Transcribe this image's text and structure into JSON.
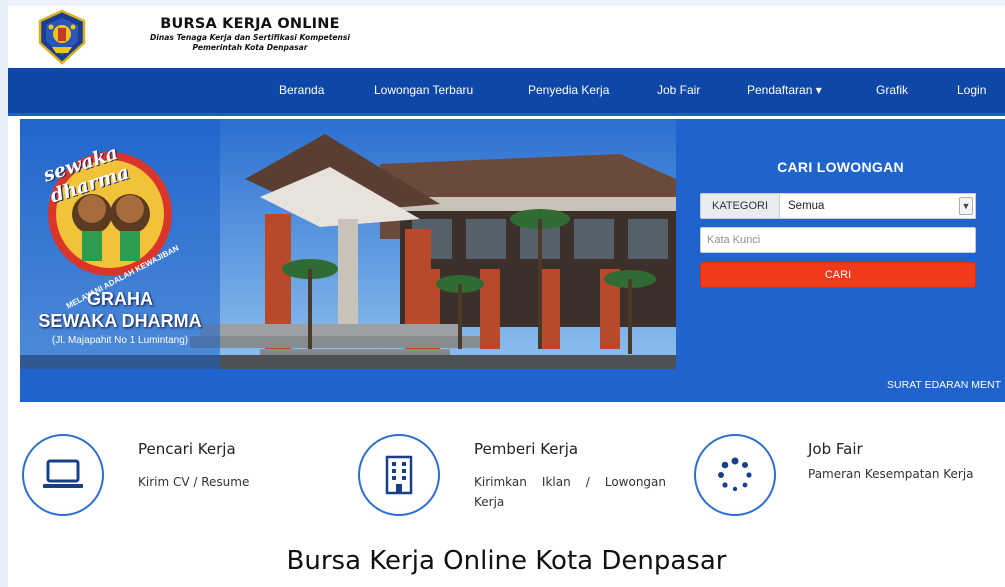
{
  "header": {
    "title": "BURSA KERJA ONLINE",
    "subtitle_line1": "Dinas Tenaga Kerja dan Sertifikasi Kompetensi",
    "subtitle_line2": "Pemerintah Kota Denpasar",
    "logo_icon": "city-crest-icon"
  },
  "nav": {
    "items": [
      {
        "label": "Beranda"
      },
      {
        "label": "Lowongan Terbaru"
      },
      {
        "label": "Penyedia Kerja"
      },
      {
        "label": "Job Fair"
      },
      {
        "label": "Pendaftaran ▾"
      },
      {
        "label": "Grafik"
      },
      {
        "label": "Login"
      }
    ],
    "color": "#0d47a8"
  },
  "hero": {
    "banner_line1": "GRAHA",
    "banner_line2": "SEWAKA DHARMA",
    "banner_address": "(Jl. Majapahit No 1 Lumintang)",
    "emblem_top_text": "sewaka dharma",
    "emblem_ribbon_text": "MELAYANI ADALAH KEWAJIBAN"
  },
  "search": {
    "title": "CARI LOWONGAN",
    "kategori_label": "KATEGORI",
    "kategori_value": "Semua",
    "keyword_placeholder": "Kata Kunci",
    "button_label": "CARI",
    "panel_color": "#1f63cc",
    "button_color": "#ef3b1b"
  },
  "ticker": {
    "text": "SURAT EDARAN MENT"
  },
  "features": [
    {
      "title": "Pencari Kerja",
      "desc": "Kirim CV / Resume",
      "icon": "laptop-icon"
    },
    {
      "title": "Pemberi Kerja",
      "desc": "Kirimkan Iklan / Lowongan Kerja",
      "icon": "building-icon"
    },
    {
      "title": "Job Fair",
      "desc": "Pameran Kesempatan Kerja",
      "icon": "spinner-icon"
    }
  ],
  "main": {
    "title": "Bursa Kerja Online Kota Denpasar"
  }
}
